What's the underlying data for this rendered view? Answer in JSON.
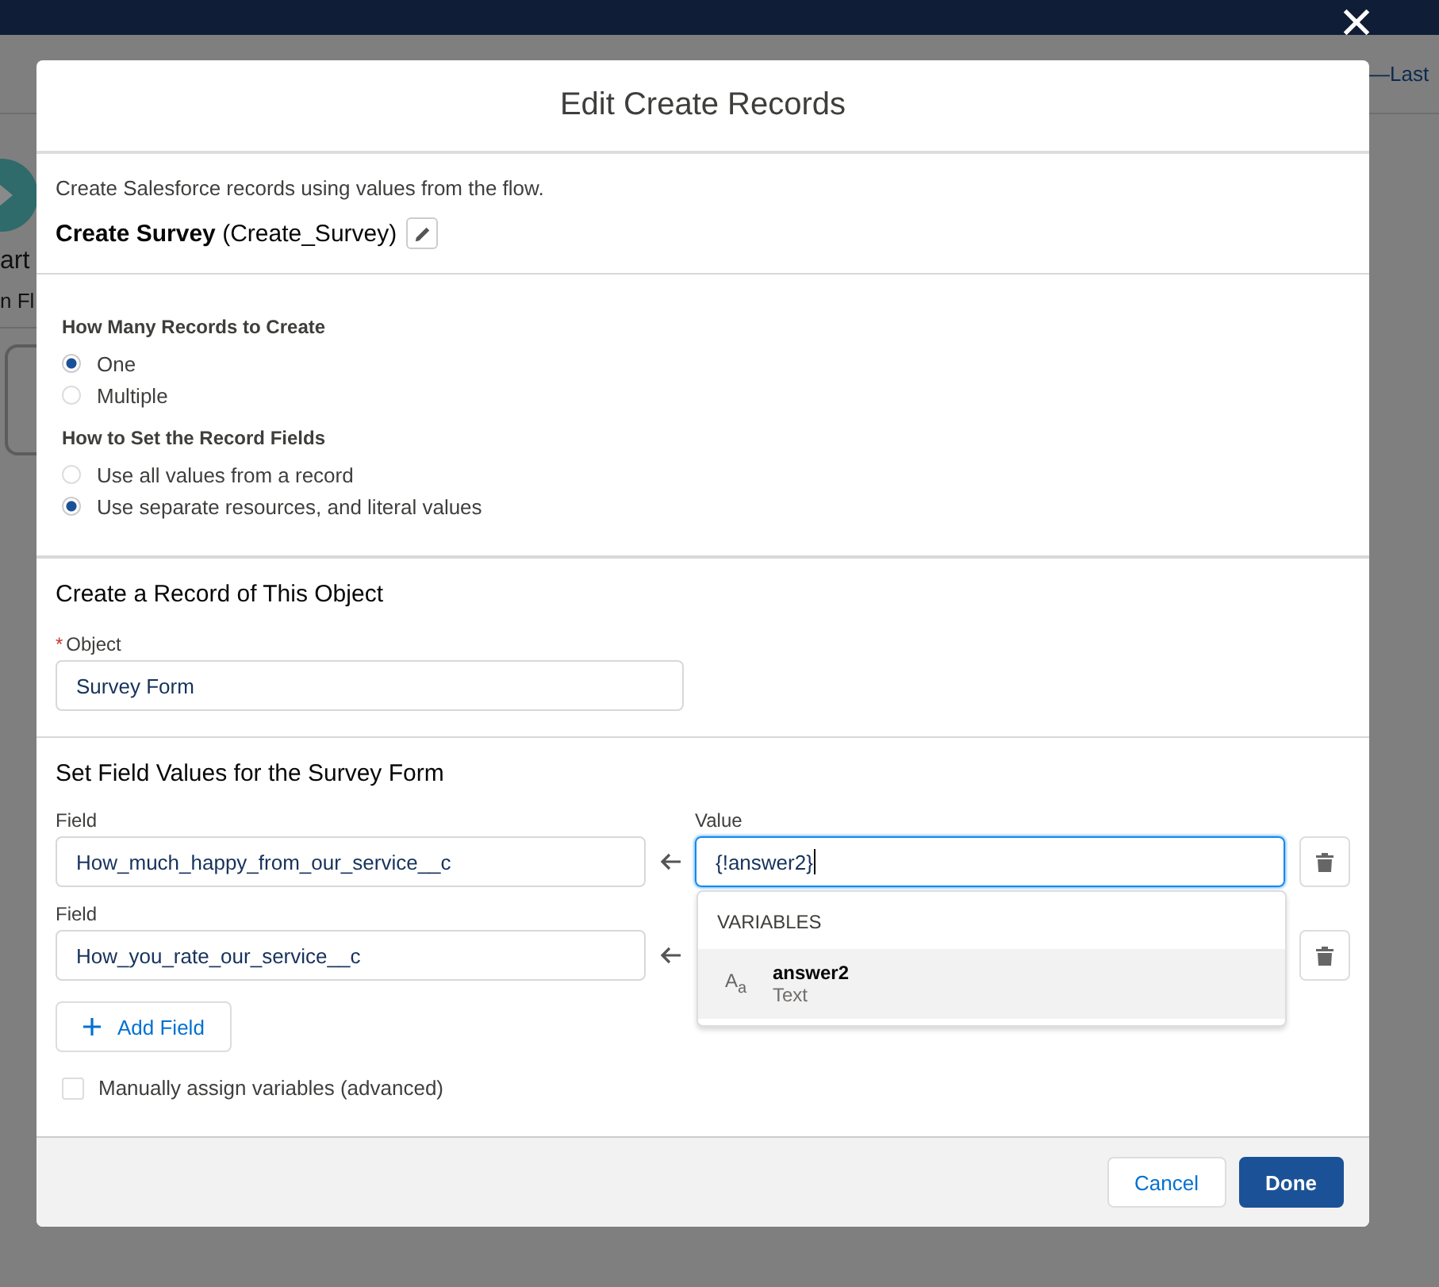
{
  "background": {
    "start_label": "art",
    "start_sublabel": "n Fl",
    "header_link": "—Last"
  },
  "modal": {
    "title": "Edit Create Records",
    "description": "Create Salesforce records using values from the flow.",
    "element": {
      "label": "Create Survey",
      "api_name": "(Create_Survey)"
    },
    "radio_groups": [
      {
        "label": "How Many Records to Create",
        "options": [
          {
            "label": "One",
            "selected": true
          },
          {
            "label": "Multiple",
            "selected": false
          }
        ]
      },
      {
        "label": "How to Set the Record Fields",
        "options": [
          {
            "label": "Use all values from a record",
            "selected": false
          },
          {
            "label": "Use separate resources, and literal values",
            "selected": true
          }
        ]
      }
    ],
    "object_section": {
      "heading": "Create a Record of This Object",
      "object_field": {
        "label": "Object",
        "required_mark": "*",
        "value": "Survey Form"
      }
    },
    "field_values": {
      "heading": "Set Field Values for the Survey Form",
      "rows": [
        {
          "field_label": "Field",
          "field": "How_much_happy_from_our_service__c",
          "value_label": "Value",
          "value": "{!answer2}",
          "focused": true
        },
        {
          "field_label": "Field",
          "field": "How_you_rate_our_service__c"
        }
      ],
      "dropdown": {
        "heading": "VARIABLES",
        "items": [
          {
            "icon": "A$_{a}$",
            "name": "answer2",
            "type": "Text",
            "selected": true
          }
        ]
      },
      "add_field": "Add Field",
      "manual_assign": {
        "label": "Manually assign variables (advanced)",
        "checked": false
      }
    },
    "buttons": [
      {
        "label": "Cancel",
        "kind": "neutral"
      },
      {
        "label": "Done",
        "kind": "brand"
      }
    ]
  }
}
